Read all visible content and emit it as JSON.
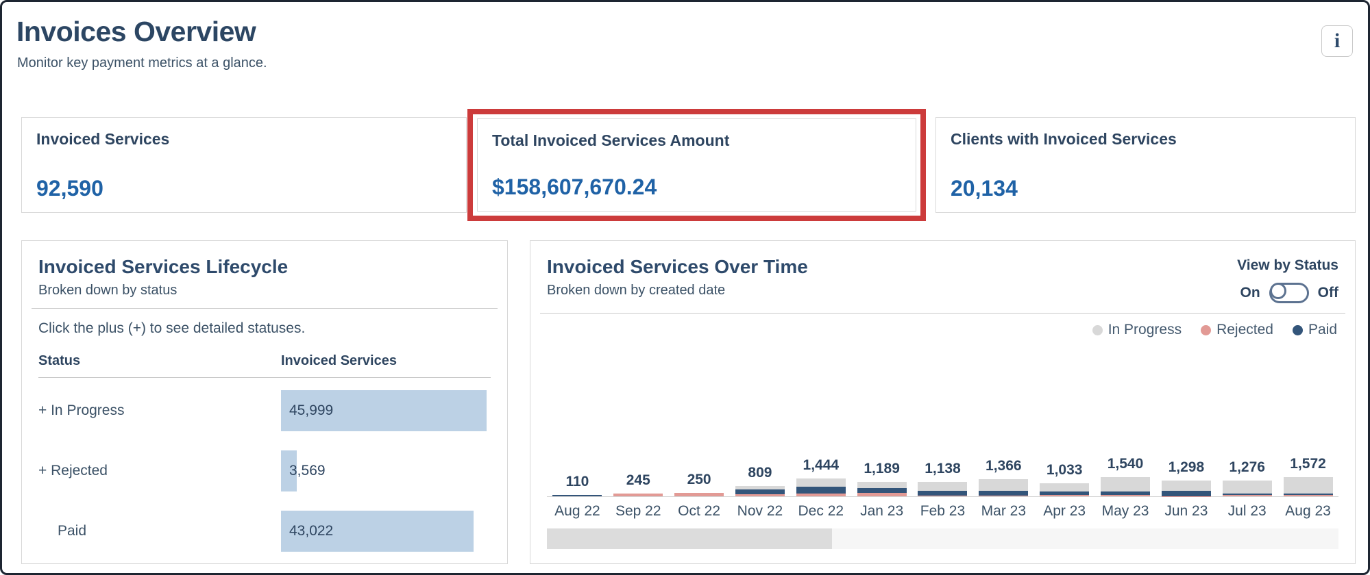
{
  "page": {
    "title": "Invoices Overview",
    "subtitle": "Monitor key payment metrics at a glance.",
    "info_icon": "i"
  },
  "kpis": [
    {
      "label": "Invoiced Services",
      "value": "92,590",
      "highlighted": false
    },
    {
      "label": "Total Invoiced Services Amount",
      "value": "$158,607,670.24",
      "highlighted": true,
      "highlight_color": "#cc3b3b"
    },
    {
      "label": "Clients with Invoiced Services",
      "value": "20,134",
      "highlighted": false
    }
  ],
  "lifecycle": {
    "title": "Invoiced Services Lifecycle",
    "subtitle": "Broken down by status",
    "hint": "Click the plus (+) to see detailed statuses.",
    "columns": [
      "Status",
      "Invoiced Services"
    ],
    "bar_color": "#bcd1e5"
  },
  "over_time": {
    "title": "Invoiced Services Over Time",
    "subtitle": "Broken down by created date",
    "view_by": {
      "label": "View by Status",
      "on_label": "On",
      "off_label": "Off",
      "knob_position": "left"
    },
    "legend": [
      {
        "label": "In Progress",
        "color": "#d8d8d8"
      },
      {
        "label": "Rejected",
        "color": "#e29a95"
      },
      {
        "label": "Paid",
        "color": "#33557a"
      }
    ]
  },
  "chart_data": [
    {
      "id": "lifecycle",
      "type": "bar",
      "orientation": "horizontal",
      "title": "Invoiced Services Lifecycle",
      "categories": [
        "+ In Progress",
        "+ Rejected",
        "Paid"
      ],
      "indent": [
        false,
        false,
        true
      ],
      "values": [
        45999,
        3569,
        43022
      ],
      "value_labels": [
        "45,999",
        "3,569",
        "43,022"
      ],
      "xmax": 46000,
      "bar_color": "#bcd1e5"
    },
    {
      "id": "over_time",
      "type": "stacked-bar",
      "title": "Invoiced Services Over Time",
      "categories": [
        "Aug 22",
        "Sep 22",
        "Oct 22",
        "Nov 22",
        "Dec 22",
        "Jan 23",
        "Feb 23",
        "Mar 23",
        "Apr 23",
        "May 23",
        "Jun 23",
        "Jul 23",
        "Aug 23"
      ],
      "totals": [
        110,
        245,
        250,
        809,
        1444,
        1189,
        1138,
        1366,
        1033,
        1540,
        1298,
        1276,
        1572
      ],
      "total_labels": [
        "110",
        "245",
        "250",
        "809",
        "1,444",
        "1,189",
        "1,138",
        "1,366",
        "1,033",
        "1,540",
        "1,298",
        "1,276",
        "1,572"
      ],
      "series": [
        {
          "name": "Rejected",
          "color": "#e29a95",
          "values": [
            0,
            245,
            250,
            160,
            230,
            260,
            60,
            50,
            100,
            110,
            20,
            100,
            100
          ]
        },
        {
          "name": "Paid",
          "color": "#33557a",
          "values": [
            110,
            0,
            0,
            380,
            520,
            420,
            370,
            420,
            310,
            270,
            420,
            110,
            110
          ]
        },
        {
          "name": "In Progress",
          "color": "#d8d8d8",
          "values": [
            0,
            0,
            0,
            269,
            694,
            509,
            708,
            896,
            623,
            1160,
            858,
            1066,
            1362
          ]
        }
      ],
      "ylim": [
        0,
        12700
      ],
      "legend_position": "top-right",
      "grid": false,
      "scrollbar": {
        "thumb_fraction": 0.36
      }
    }
  ]
}
